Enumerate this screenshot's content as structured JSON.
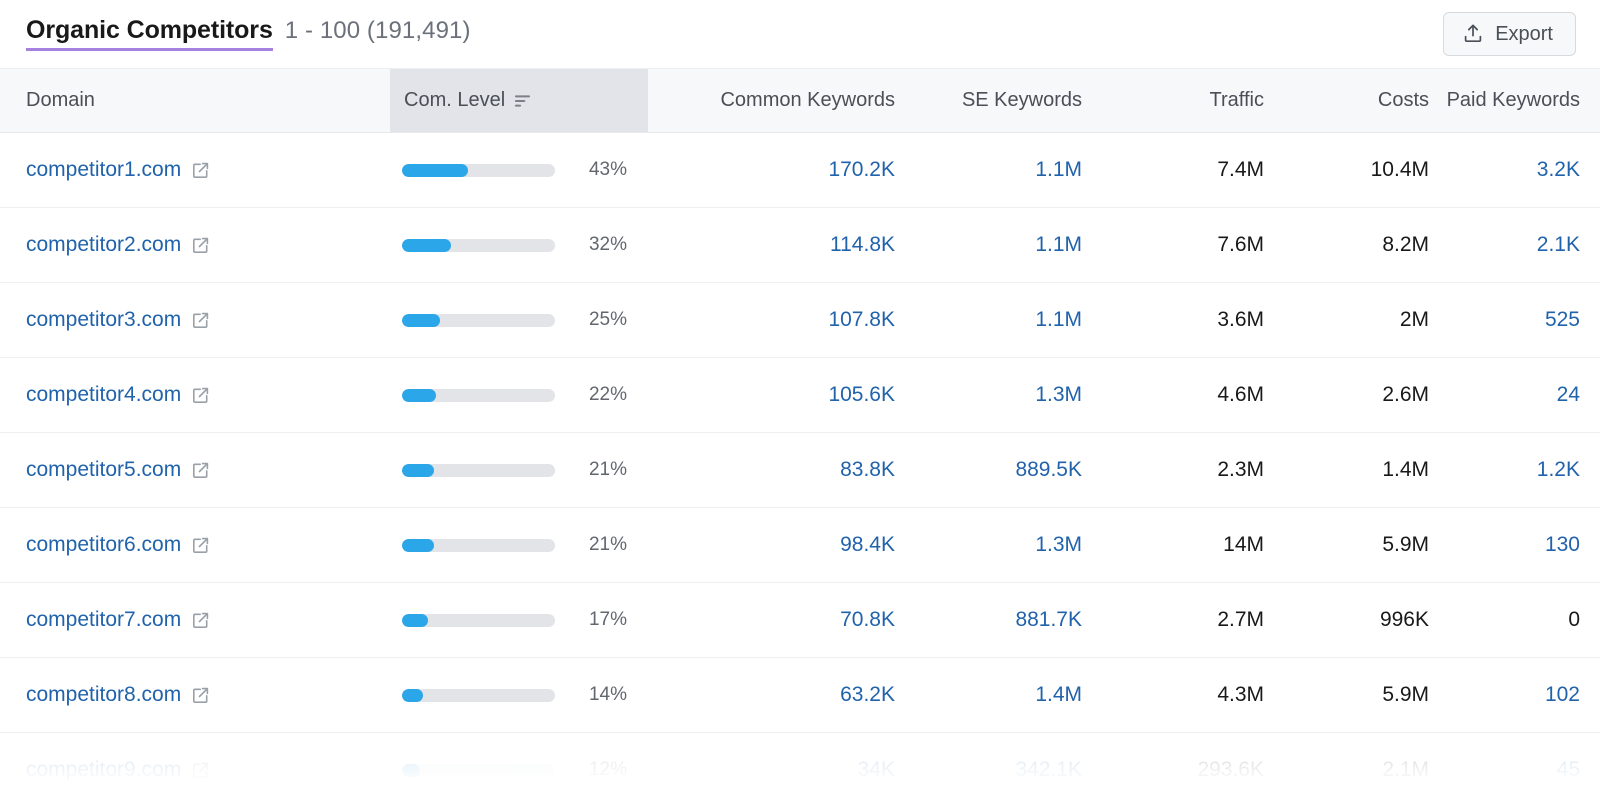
{
  "header": {
    "title": "Organic Competitors",
    "count": "1 - 100 (191,491)",
    "export_label": "Export",
    "export_icon": "upload-icon",
    "accent_underline": "#a682e0"
  },
  "table": {
    "columns": [
      {
        "key": "domain",
        "label": "Domain"
      },
      {
        "key": "level",
        "label": "Com. Level",
        "sort_icon": "sort-descending-icon",
        "active": true
      },
      {
        "key": "common",
        "label": "Common Keywords"
      },
      {
        "key": "se",
        "label": "SE Keywords"
      },
      {
        "key": "traffic",
        "label": "Traffic"
      },
      {
        "key": "costs",
        "label": "Costs"
      },
      {
        "key": "paid",
        "label": "Paid Keywords"
      }
    ],
    "link_color": "#2163ab",
    "bar_fill_color": "#2ba6e8",
    "bar_track_color": "#e2e4e8",
    "rows": [
      {
        "domain": "competitor1.com",
        "level_pct": "43%",
        "level_value": 43,
        "common": "170.2K",
        "se": "1.1M",
        "traffic": "7.4M",
        "costs": "10.4M",
        "paid": "3.2K",
        "paid_is_link": true
      },
      {
        "domain": "competitor2.com",
        "level_pct": "32%",
        "level_value": 32,
        "common": "114.8K",
        "se": "1.1M",
        "traffic": "7.6M",
        "costs": "8.2M",
        "paid": "2.1K",
        "paid_is_link": true
      },
      {
        "domain": "competitor3.com",
        "level_pct": "25%",
        "level_value": 25,
        "common": "107.8K",
        "se": "1.1M",
        "traffic": "3.6M",
        "costs": "2M",
        "paid": "525",
        "paid_is_link": true
      },
      {
        "domain": "competitor4.com",
        "level_pct": "22%",
        "level_value": 22,
        "common": "105.6K",
        "se": "1.3M",
        "traffic": "4.6M",
        "costs": "2.6M",
        "paid": "24",
        "paid_is_link": true
      },
      {
        "domain": "competitor5.com",
        "level_pct": "21%",
        "level_value": 21,
        "common": "83.8K",
        "se": "889.5K",
        "traffic": "2.3M",
        "costs": "1.4M",
        "paid": "1.2K",
        "paid_is_link": true
      },
      {
        "domain": "competitor6.com",
        "level_pct": "21%",
        "level_value": 21,
        "common": "98.4K",
        "se": "1.3M",
        "traffic": "14M",
        "costs": "5.9M",
        "paid": "130",
        "paid_is_link": true
      },
      {
        "domain": "competitor7.com",
        "level_pct": "17%",
        "level_value": 17,
        "common": "70.8K",
        "se": "881.7K",
        "traffic": "2.7M",
        "costs": "996K",
        "paid": "0",
        "paid_is_link": false
      },
      {
        "domain": "competitor8.com",
        "level_pct": "14%",
        "level_value": 14,
        "common": "63.2K",
        "se": "1.4M",
        "traffic": "4.3M",
        "costs": "5.9M",
        "paid": "102",
        "paid_is_link": true
      },
      {
        "domain": "competitor9.com",
        "level_pct": "12%",
        "level_value": 12,
        "common": "34K",
        "se": "342.1K",
        "traffic": "293.6K",
        "costs": "2.1M",
        "paid": "45",
        "paid_is_link": true,
        "faded": true
      }
    ]
  }
}
